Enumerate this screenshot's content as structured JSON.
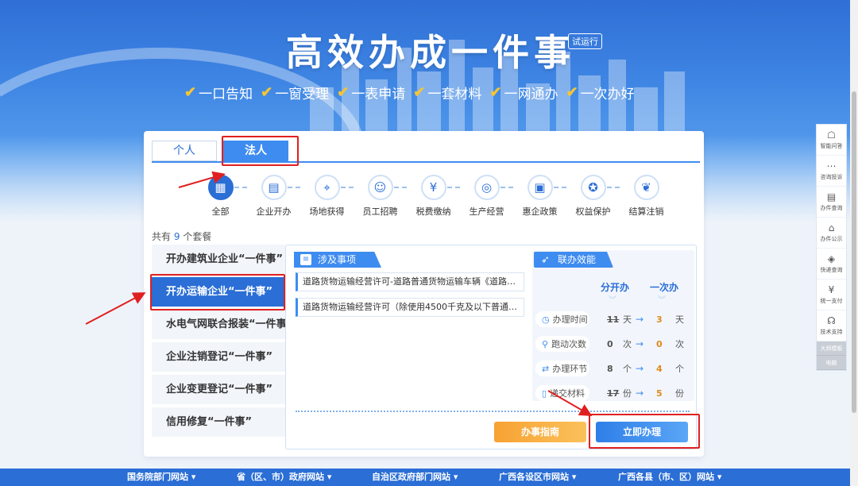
{
  "hero": {
    "title": "高效办成一件事",
    "badge": "试运行",
    "slogans": [
      "一口告知",
      "一窗受理",
      "一表申请",
      "一套材料",
      "一网通办",
      "一次办好"
    ]
  },
  "tabs": [
    {
      "label": "个人",
      "active": false
    },
    {
      "label": "法人",
      "active": true
    }
  ],
  "categories": [
    {
      "label": "全部",
      "icon": "grid-icon",
      "active": true
    },
    {
      "label": "企业开办",
      "icon": "document-icon",
      "active": false
    },
    {
      "label": "场地获得",
      "icon": "location-icon",
      "active": false
    },
    {
      "label": "员工招聘",
      "icon": "person-icon",
      "active": false
    },
    {
      "label": "税费缴纳",
      "icon": "tax-icon",
      "active": false
    },
    {
      "label": "生产经营",
      "icon": "coins-icon",
      "active": false
    },
    {
      "label": "惠企政策",
      "icon": "policy-icon",
      "active": false
    },
    {
      "label": "权益保护",
      "icon": "medal-icon",
      "active": false
    },
    {
      "label": "结算注销",
      "icon": "piggy-bank-icon",
      "active": false
    }
  ],
  "count": {
    "prefix": "共有",
    "value": "9",
    "suffix": "个套餐"
  },
  "packages": [
    {
      "label": "开办建筑业企业“一件事”",
      "active": false
    },
    {
      "label": "开办运输企业“一件事”",
      "active": true
    },
    {
      "label": "水电气网联合报装“一件事”",
      "active": false
    },
    {
      "label": "企业注销登记“一件事”",
      "active": false
    },
    {
      "label": "企业变更登记“一件事”",
      "active": false
    },
    {
      "label": "信用修复“一件事”",
      "active": false
    }
  ],
  "detail": {
    "items_title": "涉及事项",
    "items": [
      "道路货物运输经营许可-道路普通货物运输车辆《道路运...",
      "道路货物运输经营许可（除使用4500千克及以下普通货..."
    ],
    "efficiency_title": "联办效能",
    "col_separate": "分开办",
    "col_together": "一次办",
    "rows": [
      {
        "label": "办理时间",
        "icon": "clock-icon",
        "old": "11",
        "unit": "天",
        "new": "3",
        "strike": true
      },
      {
        "label": "跑动次数",
        "icon": "runner-icon",
        "old": "0",
        "unit": "次",
        "new": "0",
        "strike": false
      },
      {
        "label": "办理环节",
        "icon": "flow-icon",
        "old": "8",
        "unit": "个",
        "new": "4",
        "strike": false
      },
      {
        "label": "递交材料",
        "icon": "file-icon",
        "old": "17",
        "unit": "份",
        "new": "5",
        "strike": true
      }
    ],
    "guide_button": "办事指南",
    "apply_button": "立即办理"
  },
  "sidebar_tools": [
    {
      "label": "智能问答",
      "icon": "robot-icon"
    },
    {
      "label": "咨询投诉",
      "icon": "chat-icon"
    },
    {
      "label": "办件查询",
      "icon": "search-doc-icon"
    },
    {
      "label": "办件公示",
      "icon": "board-icon"
    },
    {
      "label": "快递查询",
      "icon": "package-icon"
    },
    {
      "label": "统一支付",
      "icon": "yen-icon"
    },
    {
      "label": "技术支持",
      "icon": "headset-icon"
    }
  ],
  "sidebar_small": [
    "大师模板",
    "电脑"
  ],
  "footer_links": [
    "国务院部门网站 ▾",
    "省（区、市）政府网站 ▾",
    "自治区政府部门网站 ▾",
    "广西各设区市网站 ▾",
    "广西各县（市、区）网站 ▾"
  ],
  "colors": {
    "primary": "#2a6ed6",
    "accent": "#3e8cf0",
    "orange": "#f7a233",
    "highlight": "#e02020"
  }
}
